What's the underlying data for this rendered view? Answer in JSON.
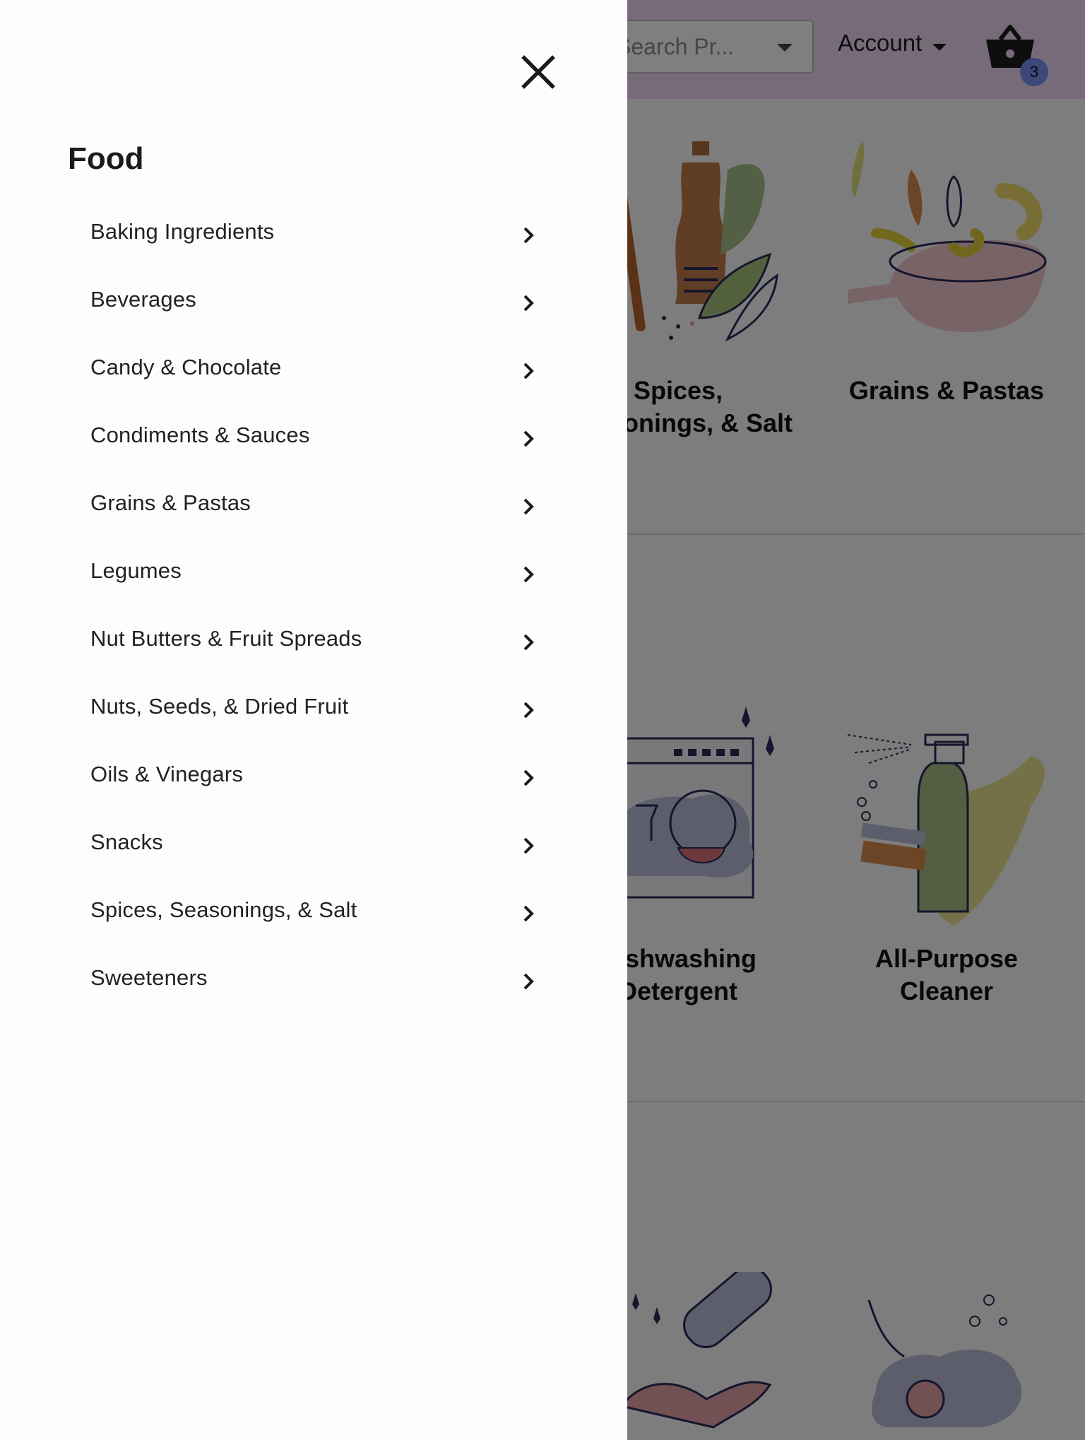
{
  "header": {
    "search_placeholder": "Search Pr...",
    "account_label": "Account",
    "cart_count": "3",
    "cart_icon": "basket-icon"
  },
  "background_cards": {
    "row1": [
      {
        "title_line1": "Spices,",
        "title_line2": "Seasonings, & Salt"
      },
      {
        "title_line1": "Grains & Pastas",
        "title_line2": ""
      }
    ],
    "row2": [
      {
        "title_line1": "Dishwashing",
        "title_line2": "Detergent"
      },
      {
        "title_line1": "All-Purpose",
        "title_line2": "Cleaner"
      }
    ]
  },
  "drawer": {
    "close_icon": "close-icon",
    "title": "Food",
    "items": [
      {
        "label": "Baking Ingredients"
      },
      {
        "label": "Beverages"
      },
      {
        "label": "Candy & Chocolate"
      },
      {
        "label": "Condiments & Sauces"
      },
      {
        "label": "Grains & Pastas"
      },
      {
        "label": "Legumes"
      },
      {
        "label": "Nut Butters & Fruit Spreads"
      },
      {
        "label": "Nuts, Seeds, & Dried Fruit"
      },
      {
        "label": "Oils & Vinegars"
      },
      {
        "label": "Snacks"
      },
      {
        "label": "Spices, Seasonings, & Salt"
      },
      {
        "label": "Sweeteners"
      }
    ],
    "item_icon": "chevron-right-icon"
  },
  "colors": {
    "header_bg": "#eed7f5",
    "badge": "#7b8ef0",
    "overlay": "rgba(0,0,0,0.5)"
  }
}
